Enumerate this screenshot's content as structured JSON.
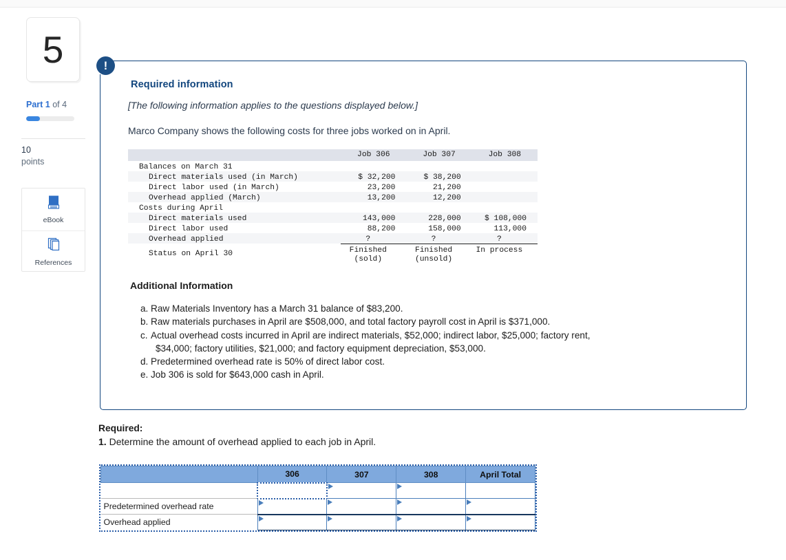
{
  "sidebar": {
    "question_number": "5",
    "part_prefix": "Part 1",
    "part_suffix": " of 4",
    "progress_percent": 28,
    "points_value": "10",
    "points_label": "points",
    "tools": [
      {
        "label": "eBook",
        "icon": "book-icon"
      },
      {
        "label": "References",
        "icon": "copy-pages-icon"
      }
    ]
  },
  "panel": {
    "badge": "!",
    "heading": "Required information",
    "italic_note": "[The following information applies to the questions displayed below.]",
    "intro": "Marco Company shows the following costs for three jobs worked on in April."
  },
  "cost_table": {
    "columns": [
      "",
      "Job 306",
      "Job 307",
      "Job 308"
    ],
    "rows": [
      {
        "label": "Balances on March 31",
        "indent": 0,
        "values": [
          "",
          "",
          ""
        ],
        "shade": false
      },
      {
        "label": "Direct materials used (in March)",
        "indent": 1,
        "values": [
          "$ 32,200",
          "$ 38,200",
          ""
        ],
        "shade": true
      },
      {
        "label": "Direct labor used (in March)",
        "indent": 1,
        "values": [
          "23,200",
          "21,200",
          ""
        ],
        "shade": false
      },
      {
        "label": "Overhead applied (March)",
        "indent": 1,
        "values": [
          "13,200",
          "12,200",
          ""
        ],
        "shade": true
      },
      {
        "label": "Costs during April",
        "indent": 0,
        "values": [
          "",
          "",
          ""
        ],
        "shade": false
      },
      {
        "label": "Direct materials used",
        "indent": 1,
        "values": [
          "143,000",
          "228,000",
          "$ 108,000"
        ],
        "shade": true
      },
      {
        "label": "Direct labor used",
        "indent": 1,
        "values": [
          "88,200",
          "158,000",
          "113,000"
        ],
        "shade": false
      },
      {
        "label": "Overhead applied",
        "indent": 1,
        "values": [
          "?",
          "?",
          "?"
        ],
        "shade": true,
        "rule": true
      }
    ],
    "status_row": {
      "label": "Status on April 30",
      "values_line1": [
        "Finished",
        "Finished",
        "In process"
      ],
      "values_line2": [
        "(sold)",
        "(unsold)",
        ""
      ]
    }
  },
  "additional_information": {
    "heading": "Additional Information",
    "items": [
      {
        "marker": "a.",
        "text": "Raw Materials Inventory has a March 31 balance of $83,200."
      },
      {
        "marker": "b.",
        "text": "Raw materials purchases in April are $508,000, and total factory payroll cost in April is $371,000."
      },
      {
        "marker": "c.",
        "text": "Actual overhead costs incurred in April are indirect materials, $52,000; indirect labor, $25,000; factory rent,",
        "continuation": "$34,000; factory utilities, $21,000; and factory equipment depreciation, $53,000."
      },
      {
        "marker": "d.",
        "text": "Predetermined overhead rate is 50% of direct labor cost."
      },
      {
        "marker": "e.",
        "text": "Job 306 is sold for $643,000 cash in April."
      }
    ]
  },
  "required": {
    "heading": "Required:",
    "number": "1.",
    "question": " Determine the amount of overhead applied to each job in April."
  },
  "answer_grid": {
    "headers": [
      "",
      "306",
      "307",
      "308",
      "April Total"
    ],
    "rows": [
      {
        "label": "",
        "cells": [
          "",
          "",
          "",
          ""
        ],
        "selected_index": 0
      },
      {
        "label": "Predetermined overhead rate",
        "cells": [
          "",
          "",
          "",
          ""
        ]
      },
      {
        "label": "Overhead applied",
        "cells": [
          "",
          "",
          "",
          ""
        ]
      }
    ]
  },
  "colors": {
    "accent_blue": "#2d6fd0",
    "panel_border": "#12467e",
    "badge_navy": "#1d4f85",
    "grid_header": "#7fa9dd",
    "table_header": "#dfe2ea"
  }
}
